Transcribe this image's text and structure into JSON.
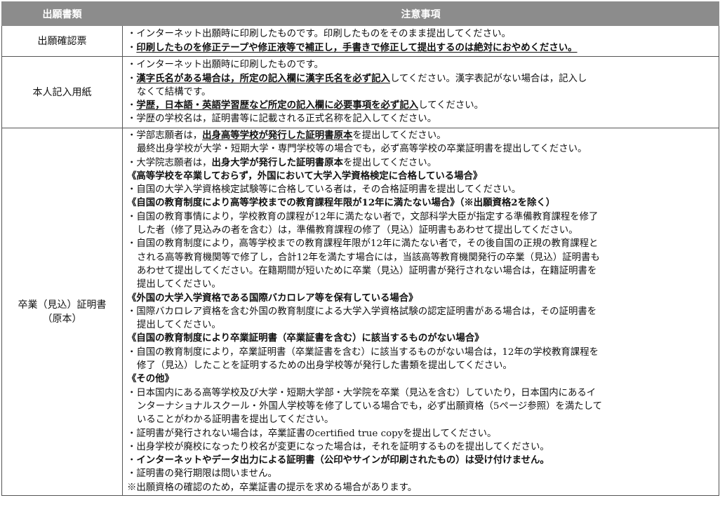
{
  "header": {
    "col1": "出願書類",
    "col2": "注意事項"
  },
  "rows": [
    {
      "label": "出願確認票",
      "notes": [
        [
          {
            "t": "・インターネット出願時に印刷したものです。印刷したものをそのまま提出してください。"
          }
        ],
        [
          {
            "t": "・"
          },
          {
            "t": "印刷したものを修正テープや修正液等で補正し，手書きで修正して提出するのは絶対におやめください。",
            "s": "bu"
          }
        ]
      ]
    },
    {
      "label": "本人記入用紙",
      "notes": [
        [
          {
            "t": "・インターネット出願時に印刷したものです。"
          }
        ],
        [
          {
            "t": "・"
          },
          {
            "t": "漢字氏名がある場合は，所定の記入欄に漢字氏名を必ず記入",
            "s": "bu"
          },
          {
            "t": "してください。漢字表記がない場合は，記入し"
          }
        ],
        [
          {
            "t": "なくて結構です。",
            "c": true
          }
        ],
        [
          {
            "t": "・"
          },
          {
            "t": "学歴，日本語・英語学習歴など所定の記入欄に必要事項を必ず記入",
            "s": "bu"
          },
          {
            "t": "してください。"
          }
        ],
        [
          {
            "t": "・学歴の学校名は，証明書等に記載される正式名称を記入してください。"
          }
        ]
      ]
    },
    {
      "label": "卒業（見込）証明書",
      "label2": "（原本）",
      "notes": [
        [
          {
            "t": "・学部志願者は，"
          },
          {
            "t": "出身高等学校が発行した証明書原本",
            "s": "bu"
          },
          {
            "t": "を提出してください。"
          }
        ],
        [
          {
            "t": "最終出身学校が大学・短期大学・専門学校等の場合でも，必ず高等学校の卒業証明書を提出してください。",
            "c": true
          }
        ],
        [
          {
            "t": "・大学院志願者は，"
          },
          {
            "t": "出身大学が発行した証明書原本",
            "s": "b"
          },
          {
            "t": "を提出してください。"
          }
        ],
        [
          {
            "t": "《高等学校を卒業しておらず，外国において大学入学資格検定に合格している場合》",
            "s": "b"
          }
        ],
        [
          {
            "t": "・自国の大学入学資格検定試験等に合格している者は，その合格証明書を提出してください。"
          }
        ],
        [
          {
            "t": "《自国の教育制度により高等学校までの教育課程年限が12年に満たない場合》（※出願資格2を除く）",
            "s": "b"
          }
        ],
        [
          {
            "t": "・自国の教育事情により，学校教育の課程が12年に満たない者で，文部科学大臣が指定する準備教育課程を修了"
          }
        ],
        [
          {
            "t": "した者（修了見込みの者を含む）は，準備教育課程の修了（見込）証明書もあわせて提出してください。",
            "c": true
          }
        ],
        [
          {
            "t": "・自国の教育制度により，高等学校までの教育課程年限が12年に満たない者で，その後自国の正規の教育課程と"
          }
        ],
        [
          {
            "t": "される高等教育機関等で修了し，合計12年を満たす場合には，当該高等教育機関発行の卒業（見込）証明書も",
            "c": true
          }
        ],
        [
          {
            "t": "あわせて提出してください。在籍期間が短いために卒業（見込）証明書が発行されない場合は，在籍証明書を",
            "c": true
          }
        ],
        [
          {
            "t": "提出してください。",
            "c": true
          }
        ],
        [
          {
            "t": "《外国の大学入学資格である国際バカロレア等を保有している場合》",
            "s": "b"
          }
        ],
        [
          {
            "t": "・国際バカロレア資格を含む外国の教育制度による大学入学資格試験の認定証明書がある場合は，その証明書を"
          }
        ],
        [
          {
            "t": "提出してください。",
            "c": true
          }
        ],
        [
          {
            "t": "《自国の教育制度により卒業証明書（卒業証書を含む）に該当するものがない場合》",
            "s": "b"
          }
        ],
        [
          {
            "t": "・自国の教育制度により，卒業証明書（卒業証書を含む）に該当するものがない場合は，12年の学校教育課程を"
          }
        ],
        [
          {
            "t": "修了（見込）したことを証明するための出身学校等が発行した書類を提出してください。",
            "c": true
          }
        ],
        [
          {
            "t": "《その他》",
            "s": "b"
          }
        ],
        [
          {
            "t": "・日本国内にある高等学校及び大学・短期大学部・大学院を卒業（見込を含む）していたり，日本国内にあるイ"
          }
        ],
        [
          {
            "t": "ンターナショナルスクール・外国人学校等を修了している場合でも，必ず出願資格（5ページ参照）を満たして",
            "c": true
          }
        ],
        [
          {
            "t": "いることがわかる証明書を提出してください。",
            "c": true
          }
        ],
        [
          {
            "t": "・証明書が発行されない場合は，卒業証書のcertified true copyを提出してください。"
          }
        ],
        [
          {
            "t": "・出身学校が廃校になったり校名が変更になった場合は，それを証明するものを提出してください。"
          }
        ],
        [
          {
            "t": "・"
          },
          {
            "t": "インターネットやデータ出力による証明書（公印やサインが印刷されたもの）は受け付けません。",
            "s": "b"
          }
        ],
        [
          {
            "t": "・証明書の発行期限は問いません。"
          }
        ],
        [
          {
            "t": "※出願資格の確認のため，卒業証書の提示を求める場合があります。"
          }
        ]
      ]
    }
  ]
}
